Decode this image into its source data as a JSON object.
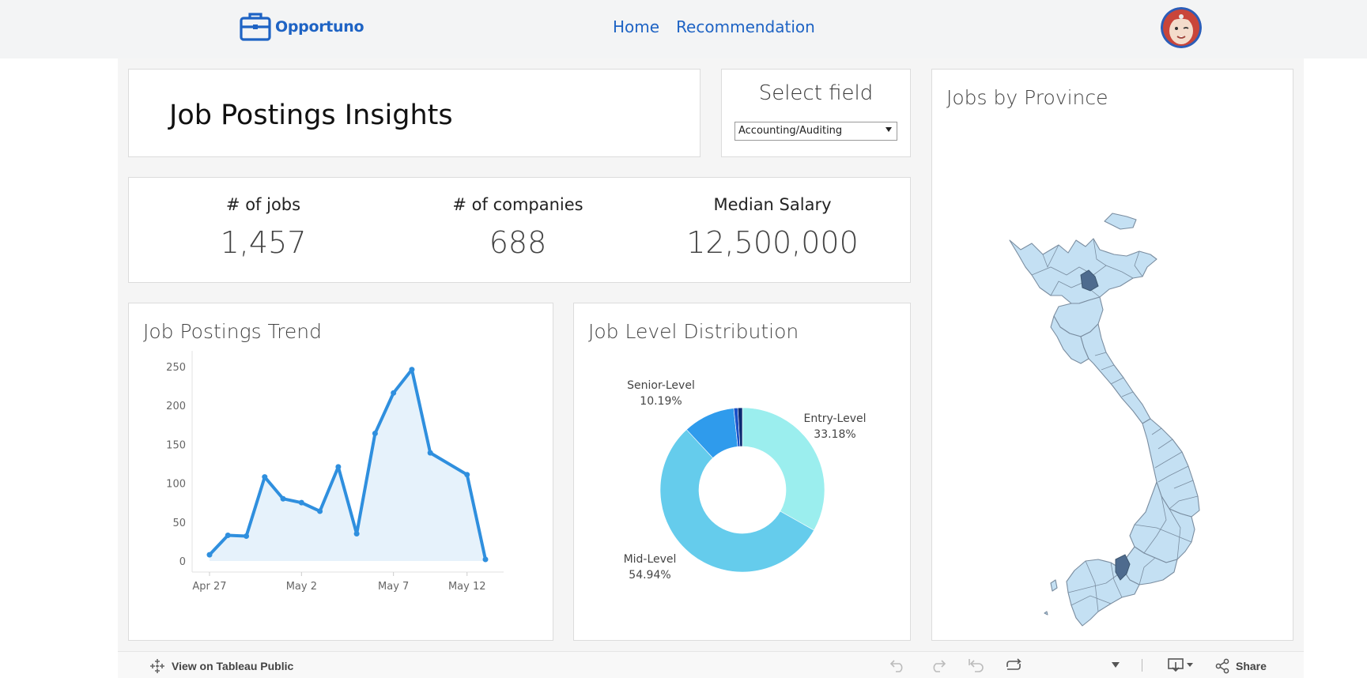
{
  "nav": {
    "brand": "Opportuno",
    "links": [
      "Home",
      "Recommendation"
    ]
  },
  "header": {
    "title": "Job Postings Insights"
  },
  "filter": {
    "label": "Select field",
    "value": "Accounting/Auditing"
  },
  "kpis": [
    {
      "label": "# of jobs",
      "value": "1,457"
    },
    {
      "label": "# of companies",
      "value": "688"
    },
    {
      "label": "Median Salary",
      "value": "12,500,000"
    }
  ],
  "cards": {
    "trend_title": "Job Postings Trend",
    "level_title": "Job Level Distribution",
    "map_title": "Jobs by Province"
  },
  "chart_data": [
    {
      "type": "line",
      "title": "Job Postings Trend",
      "x": [
        "Apr 27",
        "Apr 28",
        "Apr 29",
        "Apr 30",
        "May 1",
        "May 2",
        "May 3",
        "May 4",
        "May 5",
        "May 6",
        "May 7",
        "May 8",
        "May 9",
        "May 10",
        "May 12",
        "May 13"
      ],
      "values": [
        8,
        33,
        32,
        108,
        80,
        75,
        64,
        121,
        35,
        164,
        216,
        246,
        139,
        111,
        2
      ],
      "x_days": [
        0,
        1,
        2,
        3,
        4,
        5,
        6,
        7,
        8,
        9,
        10,
        11,
        12,
        14,
        15
      ],
      "x_ticks": [
        "Apr 27",
        "May 2",
        "May 7",
        "May 12"
      ],
      "y_ticks": [
        0,
        50,
        100,
        150,
        200,
        250
      ],
      "ylim": [
        0,
        260
      ],
      "grid": false,
      "colors": {
        "line": "#2f8fde",
        "area": "#e6f2fb"
      }
    },
    {
      "type": "pie",
      "title": "Job Level Distribution",
      "slices": [
        {
          "name": "Entry-Level",
          "pct": "33.18%",
          "value": 33.18,
          "color": "#9beeee"
        },
        {
          "name": "Mid-Level",
          "pct": "54.94%",
          "value": 54.94,
          "color": "#65ccec"
        },
        {
          "name": "Senior-Level",
          "pct": "10.19%",
          "value": 10.19,
          "color": "#2f9bec"
        },
        {
          "name": "",
          "value": 0.8,
          "color": "#1a52c8"
        },
        {
          "name": "",
          "value": 0.89,
          "color": "#0b2a72"
        }
      ]
    }
  ],
  "map": {
    "fill": "#c4e0f3",
    "highlight": "#4e6b8e",
    "stroke": "#7a8da0"
  },
  "toolbar": {
    "view_label": "View on Tableau Public",
    "share_label": "Share"
  },
  "icons": [
    "briefcase-icon",
    "avatar",
    "tableau-logo-icon",
    "undo-icon",
    "redo-icon",
    "revert-icon",
    "refresh-icon",
    "caret-down-icon",
    "download-icon",
    "share-icon"
  ]
}
